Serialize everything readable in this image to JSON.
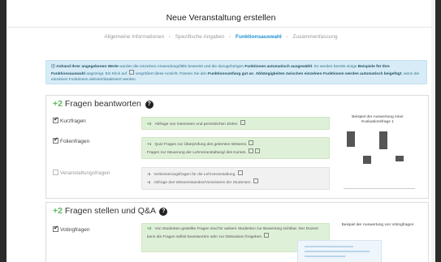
{
  "dialog": {
    "title": "Neue Veranstaltung erstellen",
    "steps": [
      "Allgemeine Informationen",
      "Spezifische Angaben",
      "Funktionsauswahl",
      "Zusammenfassung"
    ],
    "active_step": 2
  },
  "info": {
    "bold1": "Anhand Ihrer angegebenen Werte",
    "text1": " wurden die einzelnen Anwendungsfälle bewertet und die dazugehörigen ",
    "bold2": "Funktionen automatisch ausgewählt",
    "text2": ". Es werden bereits einige ",
    "bold3": "Beispiele für Ihre Funktionsauswahl",
    "text3": " angezeigt. Ein Klick auf ",
    "text4": " vergrößert diese Ansicht. Passen Sie den ",
    "bold4": "Funktionsumfang gut an",
    "text5": ". ",
    "bold5": "Abhängigkeiten zwischen einzelnen Funktionen werden automatisch beigefügt",
    "text6": ", wenn die einzelnen Funktionen aktiviert/deaktiviert werden."
  },
  "section1": {
    "score": "+2",
    "title": "Fragen beantworten",
    "options": [
      {
        "label": "Kurzfragen",
        "checked": true
      },
      {
        "label": "Folienfragen",
        "checked": true
      },
      {
        "label": "Veranstaltungsfragen",
        "checked": false
      }
    ],
    "reasons": {
      "kurz": [
        {
          "sign": "+2",
          "text": "Abfrage von Interessen und persönlichen Zielen."
        }
      ],
      "folien": [
        {
          "sign": "+1",
          "text": "Quiz-Fragen zur Überprüfung des gelernten Wissens."
        },
        {
          "sign": "",
          "text": "Fragen zur Steuerung der Lehrveranstaltung/ des Kurses."
        }
      ],
      "veranstaltung": [
        {
          "sign": "-1",
          "text": "Verbesserungsfragen für die Lehrveranstaltung."
        },
        {
          "sign": "-1",
          "text": "Abfrage des Wissensstandes/Vorwissens der Studenten."
        }
      ]
    },
    "example_title": "Beispiel der Auswertung einer Evaluationsfrage 1",
    "example_chart": {
      "type": "bar",
      "values": [
        0.8,
        0.4,
        0.9,
        0.3
      ],
      "max": 1
    }
  },
  "section2": {
    "score": "+2",
    "title": "Fragen stellen und Q&A",
    "options": [
      {
        "label": "Votingfragen",
        "checked": true
      }
    ],
    "reasons": {
      "voting": [
        {
          "sign": "+2",
          "text": "Von Studenten gestellte Fragen sind für weitere Studenten zur Bewertung sichtbar. Der Dozent kann die Fragen selbst beantworten oder zur Diskussion freigeben."
        }
      ]
    },
    "example_title": "Beispiel der Auswertung von Votingfragen"
  },
  "colors": {
    "accent": "#1b8fd0",
    "success": "#5cb85c",
    "info_bg": "#d7ecf6",
    "green_bg": "#dff0d8"
  },
  "icons": {
    "help": "question-circle-icon",
    "check": "check-icon",
    "zoom": "magnify-icon",
    "step_sep": "chevron-right-icon"
  }
}
